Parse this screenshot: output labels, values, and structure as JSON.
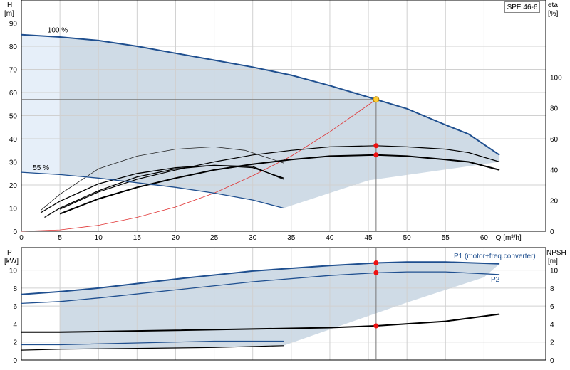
{
  "legend_label": "SPE 46-6",
  "chart_data": [
    {
      "type": "line",
      "panel": "top",
      "x_label": "Q [m³/h]",
      "y_left_label_line1": "H",
      "y_left_label_line2": "[m]",
      "y_right_label_line1": "eta",
      "y_right_label_line2": "[%]",
      "xlim": [
        0,
        68
      ],
      "ylim": [
        0,
        100
      ],
      "y_right_lim": [
        0,
        150
      ],
      "x_ticks": [
        0,
        5,
        10,
        15,
        20,
        25,
        30,
        35,
        40,
        45,
        50,
        55,
        60
      ],
      "y_ticks": [
        0,
        10,
        20,
        30,
        40,
        50,
        60,
        70,
        80,
        90
      ],
      "y_right_ticks": [
        0,
        20,
        40,
        60,
        80,
        100
      ],
      "annotations": [
        "100 %",
        "55 %"
      ],
      "series": [
        {
          "role": "head_100",
          "x": [
            0,
            5,
            10,
            15,
            20,
            25,
            30,
            35,
            40,
            45,
            46,
            50,
            55,
            58,
            62
          ],
          "y": [
            85,
            84,
            82.5,
            80,
            77,
            74,
            71,
            67.5,
            63,
            58,
            57,
            53,
            46,
            42,
            33
          ]
        },
        {
          "role": "head_55",
          "x": [
            0,
            5,
            10,
            15,
            20,
            25,
            30,
            34
          ],
          "y": [
            25.5,
            24.5,
            23,
            21,
            19,
            16.5,
            13.5,
            10
          ]
        },
        {
          "role": "efficiency_upper",
          "x": [
            5,
            10,
            15,
            20,
            25,
            30,
            35,
            40,
            46,
            50,
            55,
            58,
            62
          ],
          "y": [
            9.5,
            17,
            22.5,
            26.5,
            30,
            33,
            35,
            36.5,
            37,
            36.5,
            35.5,
            34,
            30
          ]
        },
        {
          "role": "efficiency_main",
          "x": [
            5,
            10,
            15,
            20,
            25,
            30,
            35,
            40,
            46,
            50,
            55,
            58,
            62
          ],
          "y": [
            7.5,
            14,
            19,
            23,
            26.5,
            29,
            31,
            32.5,
            33,
            32.5,
            31,
            30,
            26.5
          ]
        },
        {
          "role": "efficiency_low_a",
          "x": [
            2.5,
            5,
            10,
            15,
            20,
            25,
            30,
            34
          ],
          "y": [
            8,
            13,
            20.5,
            25,
            27.5,
            28.5,
            27.5,
            23
          ]
        },
        {
          "role": "efficiency_low_b",
          "x": [
            3,
            5,
            10,
            15,
            20,
            25,
            30,
            34
          ],
          "y": [
            6,
            10,
            17.5,
            23.5,
            27,
            28.5,
            28,
            22.5
          ]
        },
        {
          "role": "efficiency_low_thin",
          "x": [
            2.5,
            5,
            10,
            15,
            20,
            25,
            29,
            34
          ],
          "y": [
            9,
            16,
            27,
            32.5,
            35.5,
            36.5,
            35,
            29.5
          ]
        },
        {
          "role": "system_curve",
          "x": [
            0,
            5,
            10,
            15,
            20,
            25,
            30,
            35,
            40,
            46
          ],
          "y": [
            0,
            0.6,
            2.6,
            6,
            10.5,
            16.5,
            24,
            32.5,
            43,
            57
          ]
        }
      ],
      "operating_point": {
        "x": 46,
        "y": 57
      },
      "markers": [
        {
          "x": 46,
          "y": 37
        },
        {
          "x": 46,
          "y": 33
        }
      ]
    },
    {
      "type": "line",
      "panel": "bottom",
      "y_left_label_line1": "P",
      "y_left_label_line2": "[kW]",
      "y_right_label_line1": "NPSH",
      "y_right_label_line2": "[m]",
      "xlim": [
        0,
        68
      ],
      "ylim": [
        0,
        12.5
      ],
      "y_ticks": [
        0,
        2,
        4,
        6,
        8,
        10
      ],
      "y_right_ticks": [
        0,
        2,
        4,
        6,
        8,
        10
      ],
      "series": [
        {
          "name": "P1 (motor+freq.converter)",
          "x": [
            0,
            5,
            10,
            20,
            30,
            40,
            46,
            50,
            55,
            62
          ],
          "y": [
            7.3,
            7.6,
            8,
            9,
            9.9,
            10.5,
            10.8,
            10.9,
            10.9,
            10.7
          ]
        },
        {
          "name": "P2",
          "x": [
            0,
            5,
            10,
            20,
            30,
            40,
            46,
            50,
            55,
            62
          ],
          "y": [
            6.3,
            6.5,
            6.9,
            7.8,
            8.7,
            9.4,
            9.7,
            9.8,
            9.8,
            9.5
          ]
        },
        {
          "role": "npsh",
          "x": [
            0,
            5,
            20,
            40,
            46,
            55,
            62
          ],
          "y": [
            3.1,
            3.1,
            3.3,
            3.6,
            3.8,
            4.3,
            5.1
          ]
        },
        {
          "role": "power_55_a",
          "x": [
            0,
            5,
            15,
            25,
            34
          ],
          "y": [
            1.7,
            1.7,
            1.9,
            2.1,
            2.1
          ]
        },
        {
          "role": "power_55_b",
          "x": [
            0,
            5,
            15,
            25,
            34
          ],
          "y": [
            1.1,
            1.2,
            1.3,
            1.4,
            1.6
          ]
        }
      ],
      "markers": [
        {
          "x": 46,
          "y": 10.8
        },
        {
          "x": 46,
          "y": 9.7
        },
        {
          "x": 46,
          "y": 3.8
        }
      ]
    }
  ]
}
